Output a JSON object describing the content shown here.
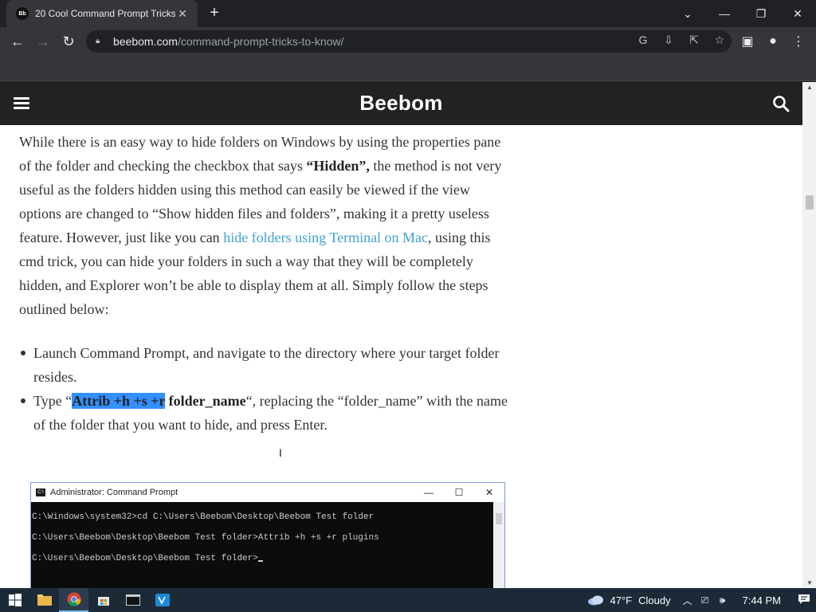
{
  "browser": {
    "tab": {
      "favicon_text": "Bb",
      "title": "20 Cool Command Prompt Tricks"
    },
    "url": {
      "domain": "beebom.com",
      "path": "/command-prompt-tricks-to-know/"
    },
    "icons": [
      "google-icon",
      "install-icon",
      "share-icon",
      "star-icon",
      "sidepanel-icon",
      "profile-icon",
      "kebab-menu-icon"
    ]
  },
  "site": {
    "logo": "Beebom"
  },
  "article": {
    "para_1a": "While there is an easy way to hide folders on Windows by using the properties pane of the folder and checking the checkbox that says ",
    "para_1_bold": "“Hidden”,",
    "para_1b": " the method is not very useful as the folders hidden using this method can easily be viewed if the view options are changed to “Show hidden files and folders”, making it a pretty useless feature. However, just like you can ",
    "para_1_link": "hide folders using Terminal on Mac",
    "para_1c": ", using this cmd trick, you can hide your folders in such a way that they will be completely hidden, and Explorer won’t be able to display them at all. Simply follow the steps outlined below:",
    "step_1": "Launch Command Prompt, and navigate to the directory where your target folder resides.",
    "step_2_a": "Type “",
    "step_2_selected": "Attrib +h +s +r",
    "step_2_code_rest": " folder_name",
    "step_2_b": "“, replacing the “folder_name” with the name of the folder that you want to hide, and press Enter."
  },
  "cmd_window": {
    "title": "Administrator: Command Prompt",
    "lines": [
      "C:\\Windows\\system32>cd C:\\Users\\Beebom\\Desktop\\Beebom Test folder",
      "C:\\Users\\Beebom\\Desktop\\Beebom Test folder>Attrib +h +s +r plugins",
      "C:\\Users\\Beebom\\Desktop\\Beebom Test folder>"
    ]
  },
  "taskbar": {
    "temperature": "47°F",
    "condition": "Cloudy",
    "time": "7:44 PM"
  }
}
